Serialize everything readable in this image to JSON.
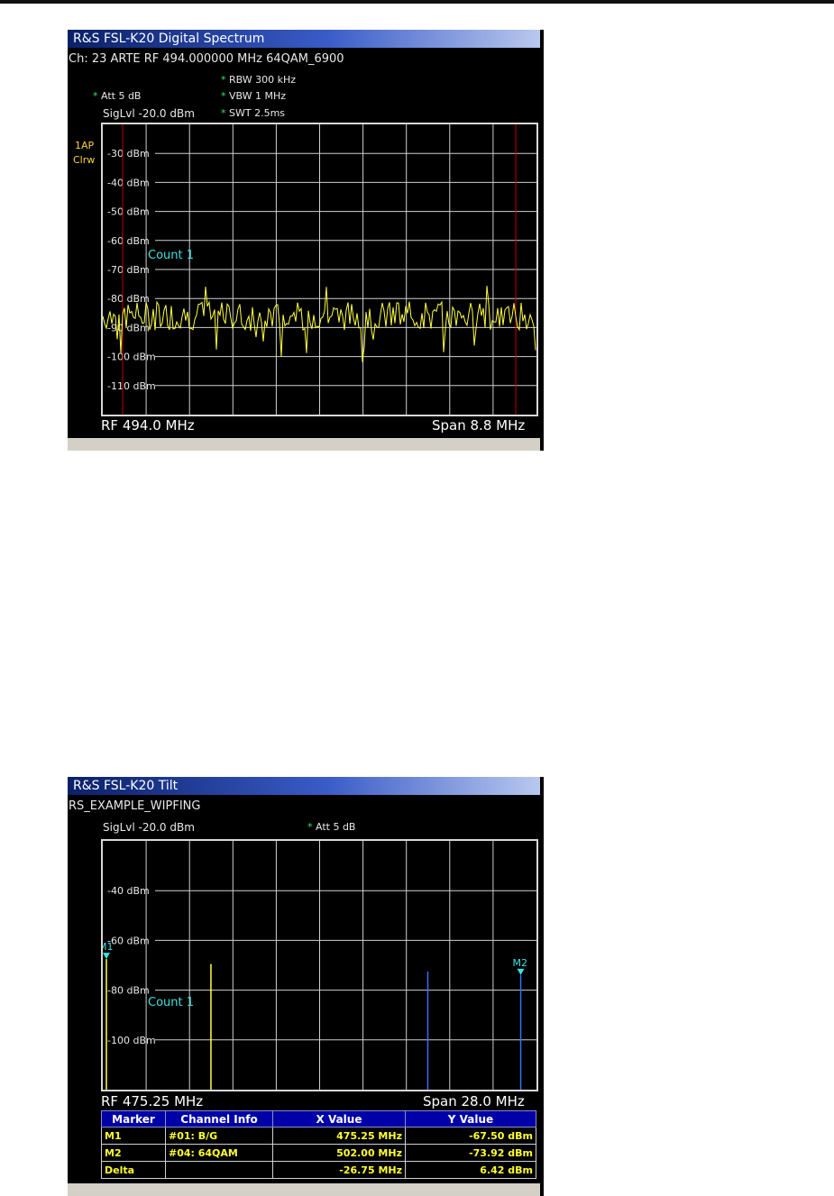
{
  "spectrum_window": {
    "title": "R&S FSL-K20 Digital Spectrum",
    "channel_line": "Ch:  23  ARTE  RF 494.000000 MHz  64QAM_6900",
    "rbw": "RBW 300 kHz",
    "vbw": "VBW 1 MHz",
    "att": "Att   5 dB",
    "swt": "SWT 2.5ms",
    "sig_lvl": "SigLvl -20.0 dBm",
    "trace_label_1": "1AP",
    "trace_label_2": "Clrw",
    "count_label": "Count 1",
    "footer_left": "RF 494.0 MHz",
    "footer_right": "Span 8.8 MHz",
    "y_ticks": [
      "-30 dBm",
      "-40 dBm",
      "-50 dBm",
      "-60 dBm",
      "-70 dBm",
      "-80 dBm",
      "-90 dBm",
      "-100 dBm",
      "-110 dBm"
    ]
  },
  "tilt_window": {
    "title": "R&S FSL-K20 Tilt",
    "subtitle": "RS_EXAMPLE_WIPFING",
    "sig_lvl": "SigLvl -20.0 dBm",
    "att": "Att 5 dB",
    "count_label": "Count 1",
    "footer_left": "RF 475.25 MHz",
    "footer_right": "Span 28.0 MHz",
    "y_ticks": [
      "-40 dBm",
      "-60 dBm",
      "-80 dBm",
      "-100 dBm"
    ],
    "markers": [
      "M1",
      "M2"
    ],
    "table": {
      "headers": [
        "Marker",
        "Channel Info",
        "X Value",
        "Y Value"
      ],
      "rows": [
        [
          "M1",
          "#01: B/G",
          "475.25 MHz",
          "-67.50 dBm"
        ],
        [
          "M2",
          "#04: 64QAM",
          "502.00 MHz",
          "-73.92 dBm"
        ],
        [
          "Delta",
          "",
          "-26.75 MHz",
          "6.42 dBm"
        ]
      ]
    }
  },
  "chart_data": [
    {
      "type": "line",
      "ylim": [
        -120,
        -20
      ],
      "yticks": [
        -30,
        -40,
        -50,
        -60,
        -70,
        -80,
        -90,
        -100,
        -110
      ],
      "center_mhz": 494.0,
      "span_mhz": 8.8,
      "noise_floor_dbm": -86,
      "grid": true,
      "colors": {
        "trace": "#ffff40",
        "limit_lines": "#c00000",
        "grid": "#cfcfcf",
        "text": "#3fe0e0"
      }
    },
    {
      "type": "bar",
      "ylim": [
        -120,
        -20
      ],
      "yticks": [
        -40,
        -60,
        -80,
        -100
      ],
      "center_mhz": 475.25,
      "span_mhz": 28.0,
      "series": [
        {
          "values": [
            -67.5,
            -69.5
          ],
          "x_mhz": [
            475.25,
            482.0
          ]
        },
        {
          "values": [
            -73.92,
            -72.5
          ],
          "x_mhz": [
            502.0,
            496.0
          ]
        }
      ],
      "grid": true,
      "colors": {
        "analog": "#ffff40",
        "digital": "#3a6dff",
        "markers": "#3fe0e0"
      }
    }
  ]
}
